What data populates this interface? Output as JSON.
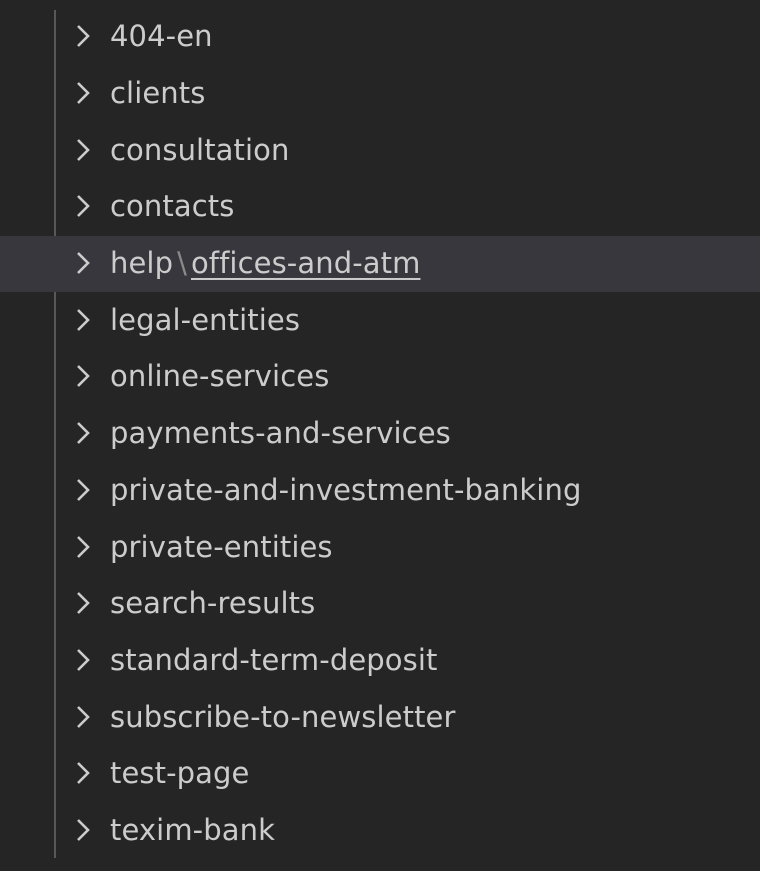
{
  "explorer": {
    "items": [
      {
        "label": "404-en"
      },
      {
        "label": "clients"
      },
      {
        "label": "consultation"
      },
      {
        "label": "contacts"
      },
      {
        "label": "help",
        "separator": "\\",
        "compact_child": "offices-and-atm",
        "selected": true
      },
      {
        "label": "legal-entities"
      },
      {
        "label": "online-services"
      },
      {
        "label": "payments-and-services"
      },
      {
        "label": "private-and-investment-banking"
      },
      {
        "label": "private-entities"
      },
      {
        "label": "search-results"
      },
      {
        "label": "standard-term-deposit"
      },
      {
        "label": "subscribe-to-newsletter"
      },
      {
        "label": "test-page"
      },
      {
        "label": "texim-bank"
      }
    ],
    "chevron_icon": "chevron-right-icon",
    "colors": {
      "background": "#252526",
      "selected_row": "#37373d",
      "text": "#cccccc",
      "indent_guide": "#585858"
    }
  }
}
